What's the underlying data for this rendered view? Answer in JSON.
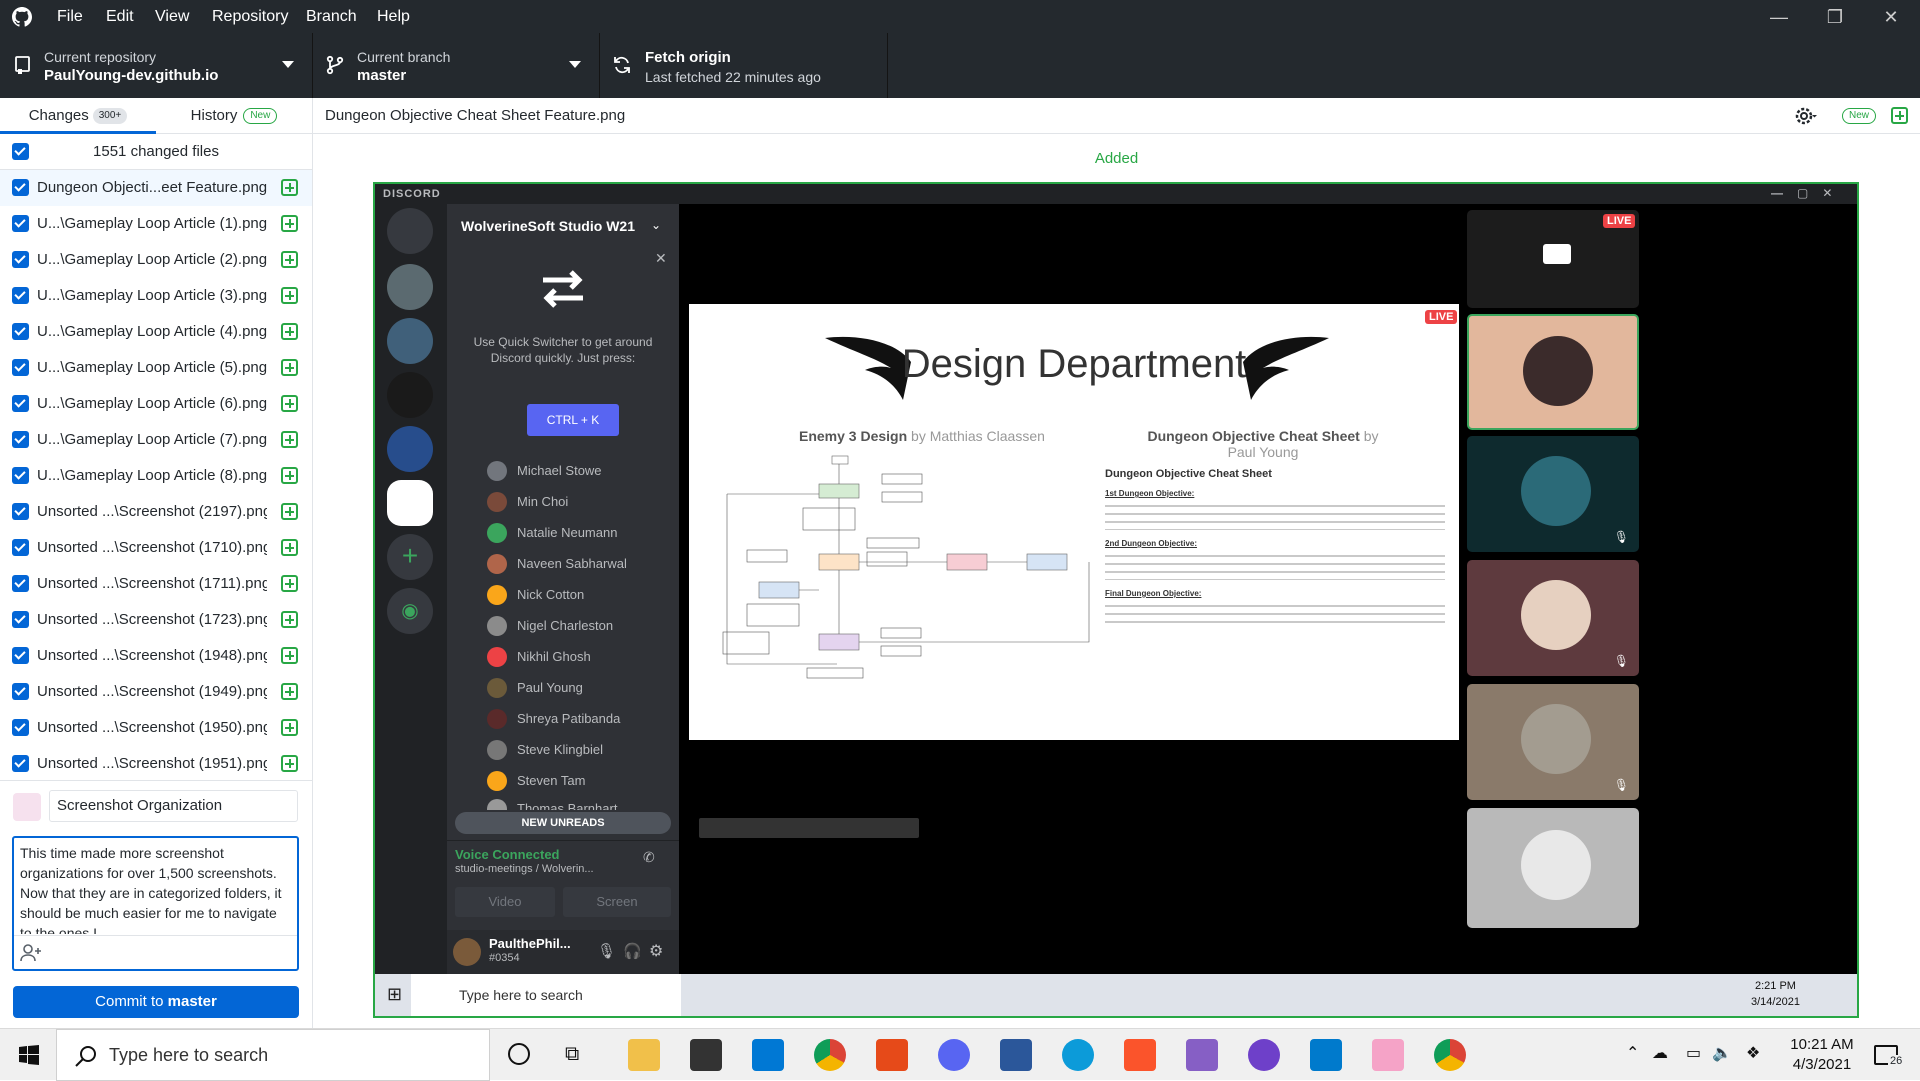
{
  "menubar": {
    "items": [
      "File",
      "Edit",
      "View",
      "Repository",
      "Branch",
      "Help"
    ],
    "window_controls": [
      "—",
      "❐",
      "✕"
    ]
  },
  "toolbar": {
    "repo_label": "Current repository",
    "repo_value": "PaulYoung-dev.github.io",
    "branch_label": "Current branch",
    "branch_value": "master",
    "fetch_label": "Fetch origin",
    "fetch_sub": "Last fetched 22 minutes ago"
  },
  "tabs": {
    "changes": "Changes",
    "changes_count": "300+",
    "history": "History",
    "history_badge": "New"
  },
  "changes": {
    "summary": "1551 changed files",
    "files": [
      "Dungeon Objecti...eet Feature.png",
      "U...\\Gameplay Loop Article (1).png",
      "U...\\Gameplay Loop Article (2).png",
      "U...\\Gameplay Loop Article (3).png",
      "U...\\Gameplay Loop Article (4).png",
      "U...\\Gameplay Loop Article (5).png",
      "U...\\Gameplay Loop Article (6).png",
      "U...\\Gameplay Loop Article (7).png",
      "U...\\Gameplay Loop Article (8).png",
      "Unsorted ...\\Screenshot (2197).png",
      "Unsorted ...\\Screenshot (1710).png",
      "Unsorted ...\\Screenshot (1711).png",
      "Unsorted ...\\Screenshot (1723).png",
      "Unsorted ...\\Screenshot (1948).png",
      "Unsorted ...\\Screenshot (1949).png",
      "Unsorted ...\\Screenshot (1950).png",
      "Unsorted ...\\Screenshot (1951).png"
    ]
  },
  "commit": {
    "summary": "Screenshot Organization",
    "description": "This time made more screenshot organizations for over 1,500 screenshots. Now that they are in categorized folders, it should be much easier for me to navigate to the ones I",
    "button_prefix": "Commit to ",
    "button_branch": "master"
  },
  "diff": {
    "file_path": "Dungeon Objective Cheat Sheet Feature.png",
    "new_badge": "New",
    "status": "Added"
  },
  "image": {
    "app_title": "DISCORD",
    "server_name": "WolverineSoft Studio W21",
    "quick_switcher_text": "Use Quick Switcher to get around Discord quickly. Just press:",
    "quick_switcher_key": "CTRL + K",
    "members": [
      "Michael Stowe",
      "Min Choi",
      "Natalie Neumann",
      "Naveen Sabharwal",
      "Nick Cotton",
      "Nigel Charleston",
      "Nikhil Ghosh",
      "Paul Young",
      "Shreya Patibanda",
      "Steve Klingbiel",
      "Steven Tam",
      "Thomas Barnhart"
    ],
    "new_unreads": "NEW UNREADS",
    "voice_status": "Voice Connected",
    "voice_channel": "studio-meetings / Wolverin...",
    "video_btn": "Video",
    "screen_btn": "Screen",
    "username": "PaulthePhil...",
    "user_tag": "#0354",
    "live": "LIVE",
    "slide_title": "Design Department",
    "slide_left_heading": "Enemy 3 Design",
    "slide_left_author": "by Matthias Claassen",
    "slide_right_heading": "Dungeon Objective Cheat Sheet",
    "slide_right_author": "by Paul Young",
    "sheet_title": "Dungeon Objective Cheat Sheet",
    "sheet_sections": [
      "1st Dungeon Objective:",
      "2nd Dungeon Objective:",
      "Final Dungeon Objective:"
    ],
    "taskbar_search": "Type here to search",
    "taskbar_time": "2:21 PM",
    "taskbar_date": "3/14/2021"
  },
  "taskbar": {
    "search_placeholder": "Type here to search",
    "time": "10:21 AM",
    "date": "4/3/2021",
    "notifications": "26"
  },
  "colors": {
    "github_dark": "#24292e",
    "accent_blue": "#0366d6",
    "added_green": "#28a745",
    "discord_bg": "#2f3136",
    "live_red": "#ed4245"
  }
}
